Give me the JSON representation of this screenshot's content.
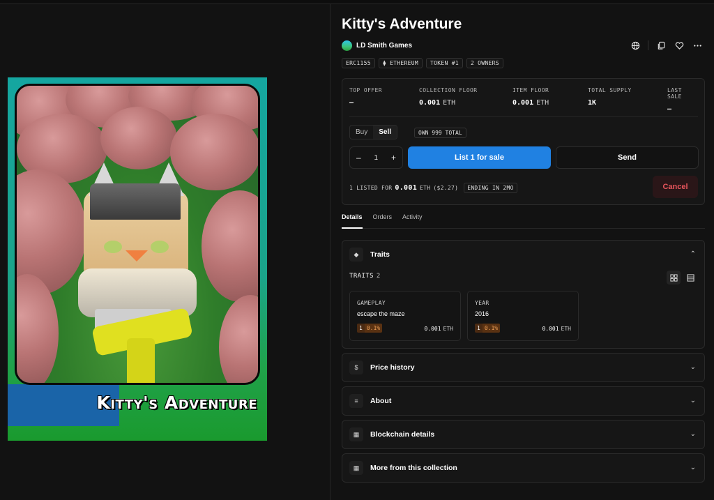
{
  "artwork": {
    "title": "Kitty's Adventure"
  },
  "item": {
    "title": "Kitty's Adventure",
    "creator": "LD Smith Games",
    "chips": [
      "ERC1155",
      "ETHEREUM",
      "TOKEN #1",
      "2 OWNERS"
    ]
  },
  "icons": {
    "globe": "globe-icon",
    "copy": "copy-icon",
    "heart": "heart-icon",
    "more": "more-icon"
  },
  "stats": [
    {
      "label": "TOP OFFER",
      "value": "–",
      "unit": ""
    },
    {
      "label": "COLLECTION FLOOR",
      "value": "0.001",
      "unit": "ETH"
    },
    {
      "label": "ITEM FLOOR",
      "value": "0.001",
      "unit": "ETH"
    },
    {
      "label": "TOTAL SUPPLY",
      "value": "1K",
      "unit": ""
    },
    {
      "label": "LAST SALE",
      "value": "–",
      "unit": ""
    }
  ],
  "trade": {
    "buy_label": "Buy",
    "sell_label": "Sell",
    "own_label": "OWN 999 TOTAL",
    "quantity": "1",
    "minus": "–",
    "plus": "+",
    "list_button": "List 1 for sale",
    "send_button": "Send",
    "listed_prefix": "1 LISTED FOR",
    "listed_price": "0.001",
    "listed_unit": "ETH",
    "listed_usd": "($2.27)",
    "ending": "ENDING IN 2MO",
    "cancel_button": "Cancel"
  },
  "tabs": [
    {
      "label": "Details",
      "active": true
    },
    {
      "label": "Orders",
      "active": false
    },
    {
      "label": "Activity",
      "active": false
    }
  ],
  "traits_panel": {
    "title": "Traits",
    "count_label": "TRAITS",
    "count": "2",
    "items": [
      {
        "type": "GAMEPLAY",
        "value": "escape the maze",
        "count": "1",
        "rarity": "0.1%",
        "price": "0.001",
        "unit": "ETH"
      },
      {
        "type": "YEAR",
        "value": "2016",
        "count": "1",
        "rarity": "0.1%",
        "price": "0.001",
        "unit": "ETH"
      }
    ]
  },
  "panels": [
    {
      "title": "Price history",
      "icon": "dollar-icon",
      "glyph": "$"
    },
    {
      "title": "About",
      "icon": "about-icon",
      "glyph": "≡"
    },
    {
      "title": "Blockchain details",
      "icon": "blockchain-icon",
      "glyph": "▦"
    },
    {
      "title": "More from this collection",
      "icon": "collection-icon",
      "glyph": "▦"
    }
  ],
  "colors": {
    "accent": "#2081e2",
    "cancel": "#e8555c",
    "rarity": "#f2a35a",
    "background": "#121212"
  }
}
